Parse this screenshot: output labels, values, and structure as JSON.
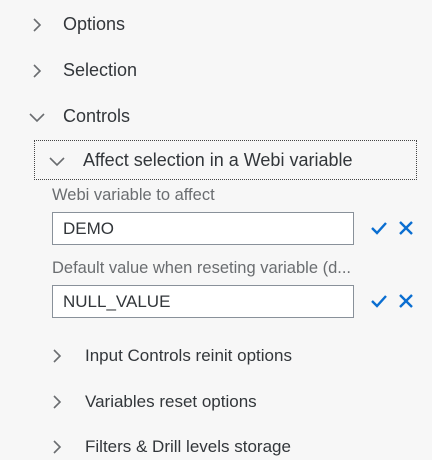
{
  "tree": {
    "options": {
      "label": "Options"
    },
    "selection": {
      "label": "Selection"
    },
    "controls": {
      "label": "Controls",
      "affect": {
        "label": "Affect selection in a Webi variable",
        "variable_field": {
          "caption": "Webi variable to affect",
          "value": "DEMO"
        },
        "default_field": {
          "caption": "Default value when reseting variable (d...",
          "value": "NULL_VALUE"
        }
      },
      "reinit": {
        "label": "Input Controls reinit options"
      },
      "reset": {
        "label": "Variables reset options"
      },
      "storage": {
        "label": "Filters & Drill levels storage"
      }
    }
  },
  "colors": {
    "accent": "#0a6ed1",
    "text": "#32363a",
    "caption": "#6a6d70",
    "chevron": "#6a6d70",
    "background": "#f7f7f7"
  },
  "icons": {
    "expand": "chevron-right-icon",
    "collapse": "chevron-down-icon",
    "confirm": "checkmark-icon",
    "cancel": "close-icon"
  }
}
